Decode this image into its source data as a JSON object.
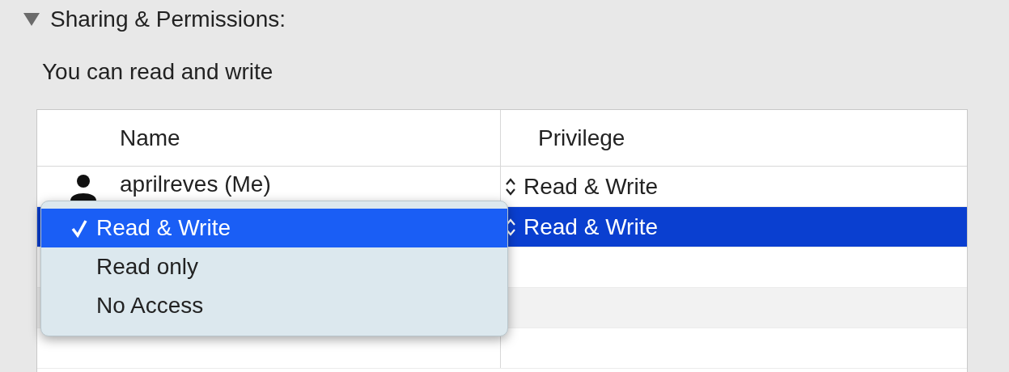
{
  "section": {
    "title": "Sharing & Permissions:",
    "expanded": true
  },
  "summary": "You can read and write",
  "table": {
    "columns": [
      "Name",
      "Privilege"
    ],
    "rows": [
      {
        "kind": "user",
        "name": "aprilreves (Me)",
        "privilege": "Read & Write",
        "selected": false
      },
      {
        "kind": "covered",
        "privilege": "Read & Write",
        "selected": true
      },
      {
        "kind": "empty",
        "selected": false
      },
      {
        "kind": "empty",
        "selected": false
      },
      {
        "kind": "empty",
        "selected": false
      }
    ]
  },
  "menu": {
    "items": [
      {
        "label": "Read & Write",
        "selected": true
      },
      {
        "label": "Read only",
        "selected": false
      },
      {
        "label": "No Access",
        "selected": false
      }
    ]
  }
}
